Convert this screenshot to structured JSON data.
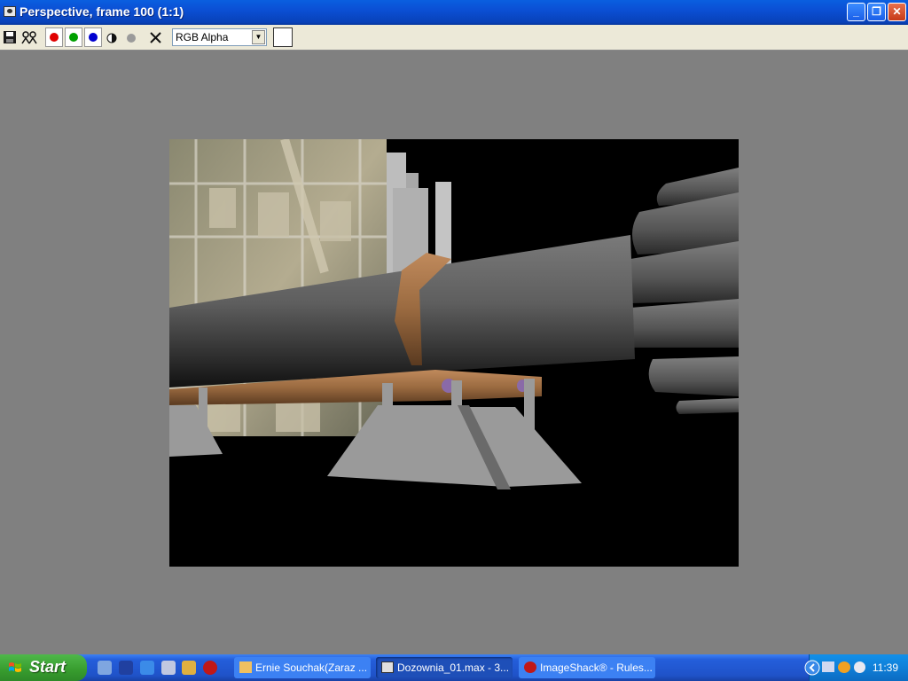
{
  "window": {
    "title": "Perspective, frame 100 (1:1)",
    "buttons": {
      "minimize": "_",
      "restore": "❐",
      "close": "✕"
    }
  },
  "toolbar": {
    "channel_select": "RGB Alpha",
    "channel_colors": {
      "red": "#e00000",
      "green": "#00a000",
      "blue": "#0000d0"
    }
  },
  "taskbar": {
    "start_label": "Start",
    "tasks": [
      {
        "label": "Ernie Souchak(Zaraz ...",
        "icon": "mail-icon"
      },
      {
        "label": "Dozownia_01.max - 3...",
        "icon": "max-icon"
      },
      {
        "label": "ImageShack® - Rules...",
        "icon": "opera-icon"
      }
    ],
    "clock": "11:39"
  }
}
